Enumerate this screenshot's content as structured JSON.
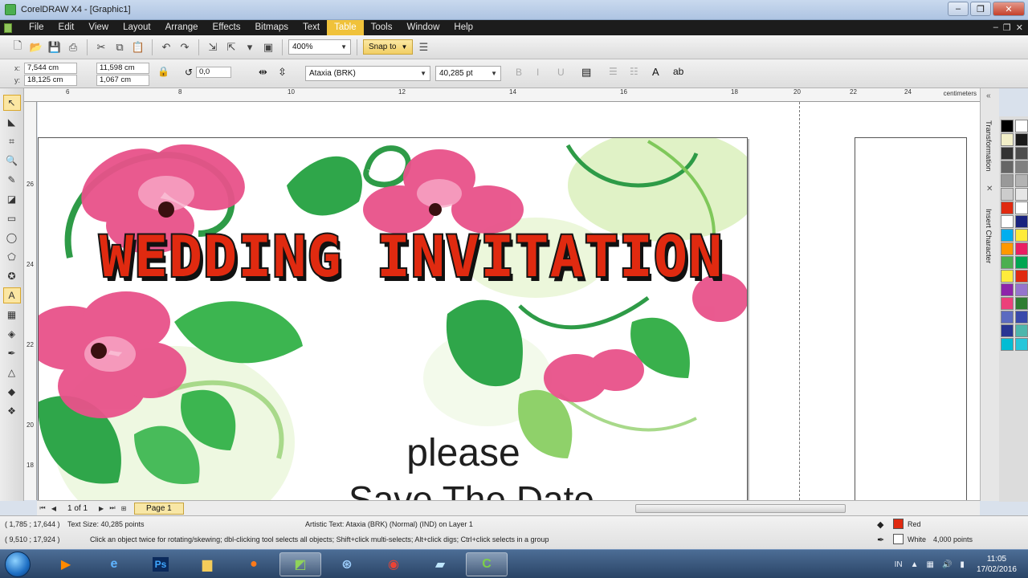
{
  "window": {
    "title": "CorelDRAW X4 - [Graphic1]",
    "min": "–",
    "max": "❐",
    "close": "✕"
  },
  "menu": [
    "File",
    "Edit",
    "View",
    "Layout",
    "Arrange",
    "Effects",
    "Bitmaps",
    "Text",
    "Table",
    "Tools",
    "Window",
    "Help"
  ],
  "menu_active": "Table",
  "toolbar": {
    "zoom_value": "400%",
    "snap_label": "Snap to"
  },
  "property_bar": {
    "x_label": "x:",
    "x_value": "7,544 cm",
    "y_label": "y:",
    "y_value": "18,125 cm",
    "w_value": "11,598 cm",
    "h_value": "1,067 cm",
    "rotation_value": "0,0",
    "font_name": "Ataxia (BRK)",
    "font_size": "40,285 pt"
  },
  "ruler": {
    "unit": "centimeters",
    "top_ticks": [
      "6",
      "8",
      "10",
      "12",
      "14",
      "16",
      "18",
      "20",
      "22",
      "24"
    ],
    "left_ticks": [
      "26",
      "24",
      "22",
      "20",
      "18"
    ]
  },
  "dockers": [
    "Transformation",
    "Insert Character"
  ],
  "artwork": {
    "headline": "WEDDING INVITATION",
    "line1": "please",
    "line2": "Save The Date"
  },
  "navigator": {
    "page_count": "1 of 1",
    "page_tab": "Page 1"
  },
  "status": {
    "cursor": "( 1,785 ; 17,644 )",
    "text_size": "Text Size: 40,285 points",
    "object_info": "Artistic Text: Ataxia (BRK) (Normal) (IND) on Layer 1",
    "cursor2": "( 9,510 ; 17,924 )",
    "hint": "Click an object twice for rotating/skewing; dbl-clicking tool selects all objects; Shift+click multi-selects; Alt+click digs; Ctrl+click selects in a group",
    "fill_name": "Red",
    "outline_name": "White",
    "outline_width": "4,000 points",
    "fill_color": "#e02a10",
    "outline_color": "#ffffff"
  },
  "taskbar": {
    "time": "11:05",
    "date": "17/02/2016",
    "lang": "IN"
  },
  "palette_colors": [
    "#000000",
    "#ffffff",
    "#f2efc8",
    "#1a1a1a",
    "#333333",
    "#4d4d4d",
    "#666666",
    "#808080",
    "#999999",
    "#b3b3b3",
    "#cccccc",
    "#e6e6e6",
    "#e02a10",
    "#ffffff",
    "#ffffff",
    "#1a237e",
    "#00aeef",
    "#ffeb3b",
    "#ff9800",
    "#e91e63",
    "#4caf50",
    "#00a651",
    "#ffeb3b",
    "#e02a10",
    "#8e24aa",
    "#9575cd",
    "#ec407a",
    "#2e7d32",
    "#5c6bc0",
    "#3949ab",
    "#283593",
    "#4db6ac",
    "#00bcd4",
    "#26c6da"
  ]
}
